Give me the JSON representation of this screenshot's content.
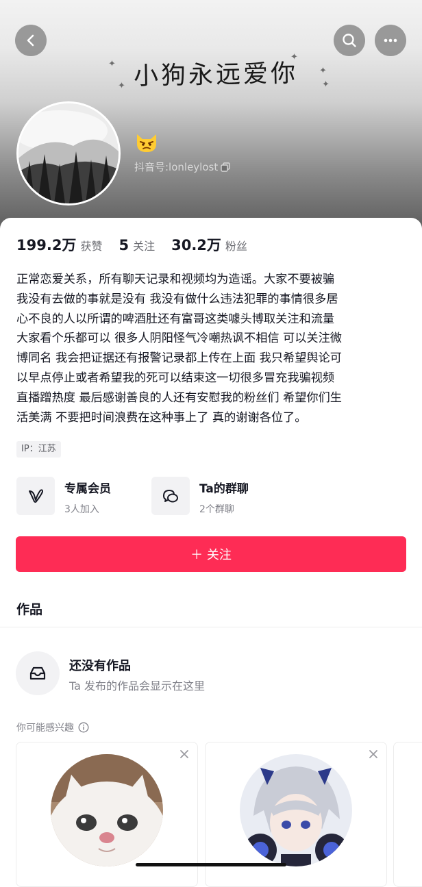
{
  "header": {
    "banner_text": "小狗永远爱你",
    "douyin_id": "抖音号:lonleylost"
  },
  "stats": [
    {
      "value": "199.2万",
      "label": "获赞"
    },
    {
      "value": "5",
      "label": "关注"
    },
    {
      "value": "30.2万",
      "label": "粉丝"
    }
  ],
  "bio": "正常恋爱关系，所有聊天记录和视频均为造谣。大家不要被骗\n我没有去做的事就是没有 我没有做什么违法犯罪的事情很多居\n心不良的人以所谓的啤酒肚还有富哥这类噱头博取关注和流量\n大家看个乐都可以 很多人阴阳怪气冷嘲热讽不相信 可以关注微\n博同名 我会把证据还有报警记录都上传在上面 我只希望舆论可\n以早点停止或者希望我的死可以结束这一切很多冒充我骗视频\n直播蹭热度 最后感谢善良的人还有安慰我的粉丝们 希望你们生\n活美满 不要把时间浪费在这种事上了 真的谢谢各位了。",
  "ip": "IP：江苏",
  "features": [
    {
      "title": "专属会员",
      "sub": "3人加入"
    },
    {
      "title": "Ta的群聊",
      "sub": "2个群聊"
    }
  ],
  "follow_label": "＋ 关注",
  "works_title": "作品",
  "empty": {
    "title": "还没有作品",
    "sub": "Ta 发布的作品会显示在这里"
  },
  "interest_label": "你可能感兴趣",
  "colors": {
    "accent": "#fe2c55",
    "text_primary": "#161823",
    "text_secondary": "#808189"
  },
  "icons": [
    "back-icon",
    "search-icon",
    "more-icon",
    "copy-icon",
    "member-icon",
    "group-chat-icon",
    "inbox-icon",
    "info-icon",
    "close-icon"
  ]
}
